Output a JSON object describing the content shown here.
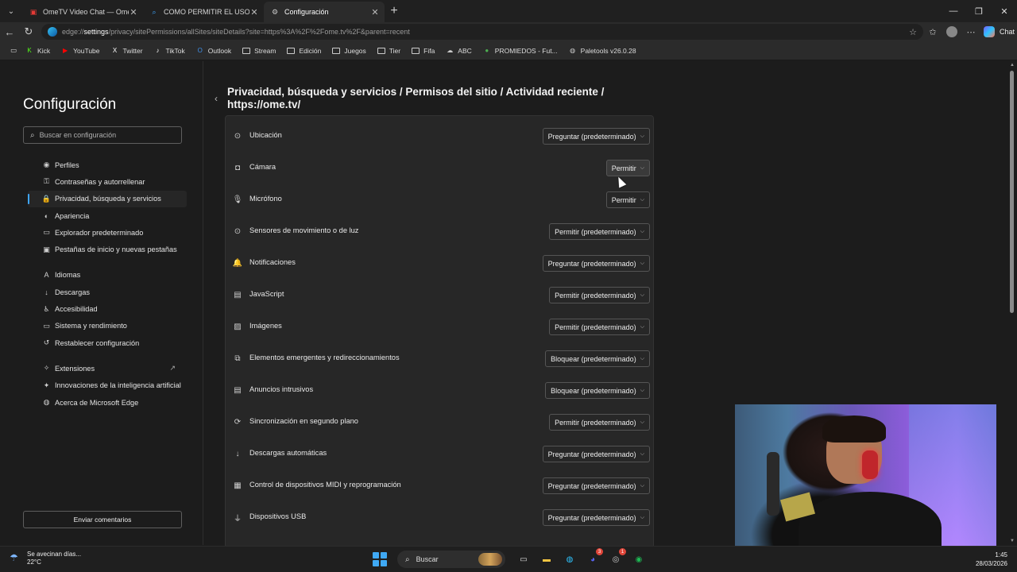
{
  "browser": {
    "tabs": [
      {
        "title": "OmeTV Video Chat — Omegle Ra",
        "icon": "ometv-icon",
        "color": "#e53935",
        "active": false
      },
      {
        "title": "COMO PERMITIR EL USO DE CAM",
        "icon": "search-icon",
        "color": "#3ea6ff",
        "active": false
      },
      {
        "title": "Configuración",
        "icon": "gear-icon",
        "color": "#cccccc",
        "active": true
      }
    ],
    "new_tab_glyph": "+",
    "address": {
      "host_prefix": "edge://",
      "host": "settings",
      "path": "/privacy/sitePermissions/allSites/siteDetails?site=https%3A%2F%2Fome.tv%2F&parent=recent"
    },
    "copilot_label": "Chat",
    "favorites": [
      {
        "label": "Kick",
        "icon": "kick-icon",
        "color": "#53fc18"
      },
      {
        "label": "YouTube",
        "icon": "youtube-icon",
        "color": "#ff0000"
      },
      {
        "label": "Twitter",
        "icon": "x-icon",
        "color": "#ffffff"
      },
      {
        "label": "TikTok",
        "icon": "tiktok-icon",
        "color": "#ffffff"
      },
      {
        "label": "Outlook",
        "icon": "outlook-icon",
        "color": "#3f8ee8"
      },
      {
        "label": "Stream",
        "icon": "folder-icon",
        "color": "#cccccc"
      },
      {
        "label": "Edición",
        "icon": "folder-icon",
        "color": "#cccccc"
      },
      {
        "label": "Juegos",
        "icon": "folder-icon",
        "color": "#cccccc"
      },
      {
        "label": "Tier",
        "icon": "folder-icon",
        "color": "#cccccc"
      },
      {
        "label": "Fifa",
        "icon": "folder-icon",
        "color": "#cccccc"
      },
      {
        "label": "ABC",
        "icon": "cloud-icon",
        "color": "#cccccc"
      },
      {
        "label": "PROMIEDOS - Fut...",
        "icon": "promiedos-icon",
        "color": "#4caf50"
      },
      {
        "label": "Paletools v26.0.28",
        "icon": "globe-icon",
        "color": "#cccccc"
      }
    ]
  },
  "settings": {
    "title": "Configuración",
    "search_placeholder": "Buscar en configuración",
    "nav": [
      {
        "label": "Perfiles",
        "icon": "profile-icon",
        "glyph": "◉",
        "active": false
      },
      {
        "label": "Contraseñas y autorrellenar",
        "icon": "key-icon",
        "glyph": "⚿",
        "active": false
      },
      {
        "label": "Privacidad, búsqueda y servicios",
        "icon": "lock-icon",
        "glyph": "🔒",
        "active": true
      },
      {
        "label": "Apariencia",
        "icon": "appearance-icon",
        "glyph": "◐",
        "active": false
      },
      {
        "label": "Explorador predeterminado",
        "icon": "browser-icon",
        "glyph": "▭",
        "active": false
      },
      {
        "label": "Pestañas de inicio y nuevas pestañas",
        "icon": "tabs-icon",
        "glyph": "▣",
        "active": false
      },
      {
        "gap": true
      },
      {
        "label": "Idiomas",
        "icon": "language-icon",
        "glyph": "A",
        "active": false
      },
      {
        "label": "Descargas",
        "icon": "download-icon",
        "glyph": "↓",
        "active": false
      },
      {
        "label": "Accesibilidad",
        "icon": "accessibility-icon",
        "glyph": "♿",
        "active": false
      },
      {
        "label": "Sistema y rendimiento",
        "icon": "system-icon",
        "glyph": "▭",
        "active": false
      },
      {
        "label": "Restablecer configuración",
        "icon": "reset-icon",
        "glyph": "↺",
        "active": false
      },
      {
        "gap": true
      },
      {
        "label": "Extensiones",
        "icon": "extensions-icon",
        "glyph": "✧",
        "active": false,
        "external": true
      },
      {
        "label": "Innovaciones de la inteligencia artificial",
        "icon": "ai-icon",
        "glyph": "✦",
        "active": false
      },
      {
        "label": "Acerca de Microsoft Edge",
        "icon": "edge-icon",
        "glyph": "◍",
        "active": false
      }
    ],
    "feedback_button": "Enviar comentarios",
    "breadcrumb": "Privacidad, búsqueda y servicios  /  Permisos del sitio  /  Actividad reciente  /  https://ome.tv/",
    "permissions": [
      {
        "label": "Ubicación",
        "icon": "location-icon",
        "glyph": "⊙",
        "value": "Preguntar (predeterminado)"
      },
      {
        "label": "Cámara",
        "icon": "camera-icon",
        "glyph": "◘",
        "value": "Permitir",
        "hover": true
      },
      {
        "label": "Micrófono",
        "icon": "microphone-icon",
        "glyph": "🎙",
        "value": "Permitir"
      },
      {
        "label": "Sensores de movimiento o de luz",
        "icon": "sensor-icon",
        "glyph": "⊙",
        "value": "Permitir (predeterminado)"
      },
      {
        "label": "Notificaciones",
        "icon": "bell-icon",
        "glyph": "🔔",
        "value": "Preguntar (predeterminado)"
      },
      {
        "label": "JavaScript",
        "icon": "javascript-icon",
        "glyph": "▤",
        "value": "Permitir (predeterminado)"
      },
      {
        "label": "Imágenes",
        "icon": "image-icon",
        "glyph": "▨",
        "value": "Permitir (predeterminado)"
      },
      {
        "label": "Elementos emergentes y redireccionamientos",
        "icon": "popup-icon",
        "glyph": "⧉",
        "value": "Bloquear (predeterminado)"
      },
      {
        "label": "Anuncios intrusivos",
        "icon": "ads-icon",
        "glyph": "▤",
        "value": "Bloquear (predeterminado)"
      },
      {
        "label": "Sincronización en segundo plano",
        "icon": "sync-icon",
        "glyph": "⟳",
        "value": "Permitir (predeterminado)"
      },
      {
        "label": "Descargas automáticas",
        "icon": "download-icon",
        "glyph": "↓",
        "value": "Preguntar (predeterminado)"
      },
      {
        "label": "Control de dispositivos MIDI y reprogramación",
        "icon": "midi-icon",
        "glyph": "▦",
        "value": "Preguntar (predeterminado)"
      },
      {
        "label": "Dispositivos USB",
        "icon": "usb-icon",
        "glyph": "⏚",
        "value": "Preguntar (predeterminado)"
      },
      {
        "label": "",
        "icon": "port-icon",
        "glyph": "▭",
        "value": ""
      }
    ]
  },
  "taskbar": {
    "weather_text": "Se avecinan días...",
    "weather_temp": "22°C",
    "search_label": "Buscar",
    "time": "1:45",
    "date": "28/03/2026",
    "apps": [
      {
        "icon": "task-view-icon",
        "color": "#dddddd",
        "glyph": "▭"
      },
      {
        "icon": "file-explorer-icon",
        "color": "#f5c542",
        "glyph": "▬"
      },
      {
        "icon": "edge-icon",
        "color": "#2ec4ff",
        "glyph": "◍"
      },
      {
        "icon": "discord-icon",
        "color": "#5865f2",
        "glyph": "◕",
        "badge": "3"
      },
      {
        "icon": "steam-icon",
        "color": "#cccccc",
        "glyph": "◎",
        "badge": "1"
      },
      {
        "icon": "spotify-icon",
        "color": "#1db954",
        "glyph": "◉"
      }
    ]
  },
  "accent_color": "#3ea6ff"
}
